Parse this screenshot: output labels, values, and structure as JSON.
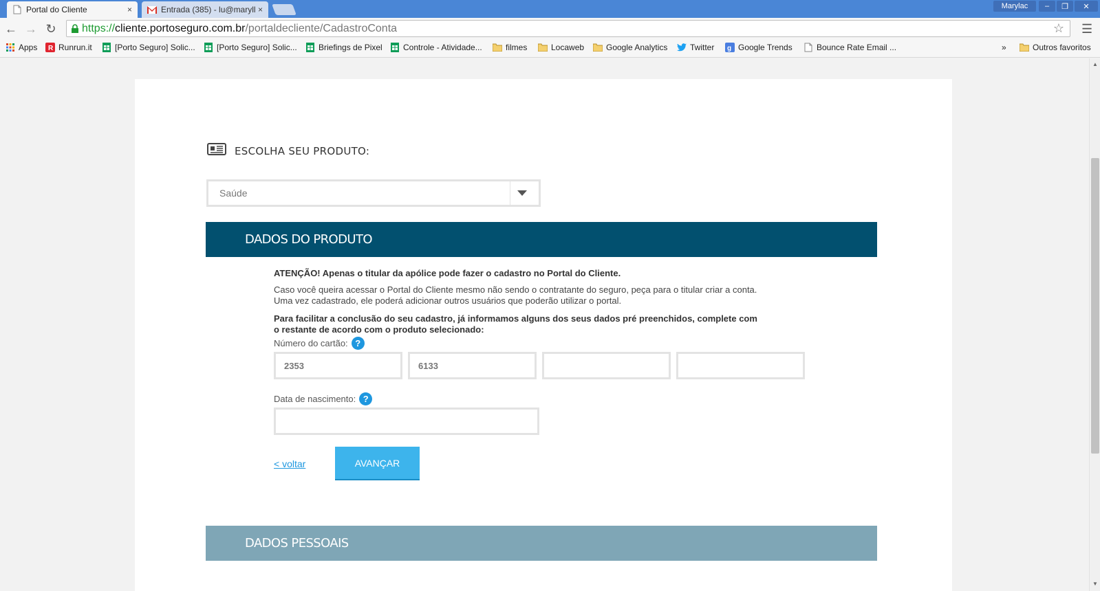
{
  "browser": {
    "tabs": [
      {
        "title": "Portal do Cliente",
        "close": "×"
      },
      {
        "title": "Entrada (385) - lu@maryll",
        "close": "×"
      }
    ],
    "profile": "Marylac",
    "window_buttons": {
      "minimize": "–",
      "restore": "❐",
      "close": "✕"
    },
    "url": {
      "scheme": "https://",
      "host": "cliente.portoseguro.com.br",
      "path": "/portaldecliente/CadastroConta"
    },
    "bookmarks": [
      {
        "label": "Apps",
        "icon": "apps-grid-icon"
      },
      {
        "label": "Runrun.it",
        "icon": "runrun-icon"
      },
      {
        "label": "[Porto Seguro] Solic...",
        "icon": "sheets-icon"
      },
      {
        "label": "[Porto Seguro] Solic...",
        "icon": "sheets-icon"
      },
      {
        "label": "Briefings de Pixel",
        "icon": "sheets-icon"
      },
      {
        "label": "Controle - Atividade...",
        "icon": "sheets-icon"
      },
      {
        "label": "filmes",
        "icon": "folder-icon"
      },
      {
        "label": "Locaweb",
        "icon": "folder-icon"
      },
      {
        "label": "Google Analytics",
        "icon": "folder-icon"
      },
      {
        "label": "Twitter",
        "icon": "twitter-icon"
      },
      {
        "label": "Google Trends",
        "icon": "google-icon"
      },
      {
        "label": "Bounce Rate Email ...",
        "icon": "page-icon"
      }
    ],
    "overflow": "»",
    "other_bookmarks": "Outros favoritos"
  },
  "page": {
    "choose_product_label": "ESCOLHA SEU PRODUTO:",
    "product_select_value": "Saúde",
    "section_product": "DADOS DO PRODUTO",
    "attention": "ATENÇÃO! Apenas o titular da apólice pode fazer o cadastro no Portal do Cliente.",
    "info_line1": "Caso você queira acessar o Portal do Cliente mesmo não sendo o contratante do seguro, peça para o titular criar a conta.",
    "info_line2": "Uma vez cadastrado, ele poderá adicionar outros usuários que poderão utilizar o portal.",
    "prefill_line1": "Para facilitar a conclusão do seu cadastro, já informamos alguns dos seus dados pré preenchidos, complete com",
    "prefill_line2": "o restante de acordo com o produto selecionado:",
    "card_number_label": "Número do cartão:",
    "card_parts": [
      "2353",
      "6133",
      "",
      ""
    ],
    "birth_date_label": "Data de nascimento:",
    "birth_date_value": "",
    "help_glyph": "?",
    "back_link": "< voltar",
    "advance_button": "AVANÇAR",
    "section_personal": "DADOS PESSOAIS"
  },
  "colors": {
    "band_dark": "#02506f",
    "band_light": "#7fa6b6",
    "accent": "#3db4ec",
    "help_blue": "#1e97df",
    "tab_strip": "#4a86d6"
  }
}
